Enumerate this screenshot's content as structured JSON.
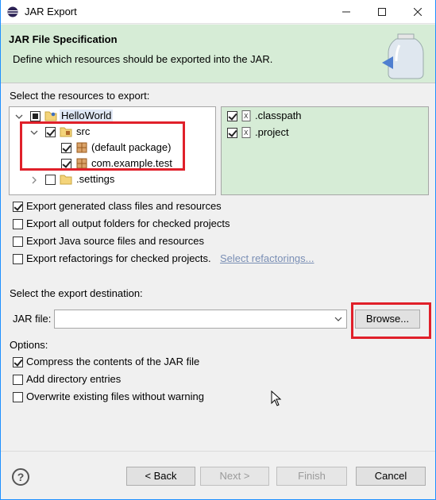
{
  "window": {
    "title": "JAR Export"
  },
  "banner": {
    "title": "JAR File Specification",
    "description": "Define which resources should be exported into the JAR."
  },
  "resources": {
    "label": "Select the resources to export:",
    "tree": [
      {
        "label": "HelloWorld",
        "icon": "project-folder-icon",
        "state": "partial",
        "expanded": true
      },
      {
        "label": "src",
        "icon": "source-folder-icon",
        "state": "checked",
        "expanded": true
      },
      {
        "label": "(default package)",
        "icon": "package-icon",
        "state": "checked"
      },
      {
        "label": "com.example.test",
        "icon": "package-icon",
        "state": "checked"
      },
      {
        "label": ".settings",
        "icon": "folder-icon",
        "state": "unchecked",
        "expanded": false
      }
    ],
    "files": [
      {
        "label": ".classpath",
        "icon": "xml-file-icon",
        "state": "checked"
      },
      {
        "label": ".project",
        "icon": "xml-file-icon",
        "state": "checked"
      }
    ]
  },
  "options_export": [
    {
      "label": "Export generated class files and resources",
      "checked": true
    },
    {
      "label": "Export all output folders for checked projects",
      "checked": false
    },
    {
      "label": "Export Java source files and resources",
      "checked": false
    },
    {
      "label": "Export refactorings for checked projects.",
      "checked": false,
      "link": "Select refactorings..."
    }
  ],
  "destination": {
    "label": "Select the export destination:",
    "jar_label": "JAR file:",
    "jar_value": "",
    "browse": "Browse..."
  },
  "options": {
    "label": "Options:",
    "items": [
      {
        "label": "Compress the contents of the JAR file",
        "checked": true
      },
      {
        "label": "Add directory entries",
        "checked": false
      },
      {
        "label": "Overwrite existing files without warning",
        "checked": false
      }
    ]
  },
  "buttons": {
    "back": "< Back",
    "next": "Next >",
    "finish": "Finish",
    "cancel": "Cancel"
  },
  "colors": {
    "banner": "#d6ecd6",
    "highlight": "#e0202a"
  }
}
